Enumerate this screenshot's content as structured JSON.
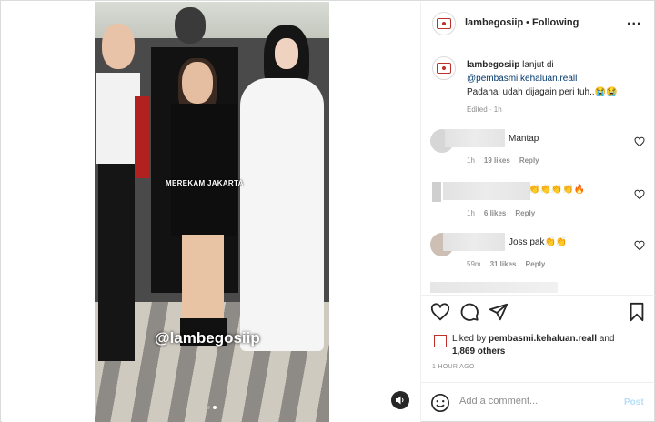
{
  "video": {
    "watermark_top": "MEREKAM JAKARTA",
    "watermark_bottom": "@lambegosiip",
    "carousel": {
      "count": 2,
      "active": 2
    }
  },
  "header": {
    "username": "lambegosiip",
    "separator": "•",
    "follow_state": "Following",
    "more_label": "..."
  },
  "caption": {
    "username": "lambegosiip",
    "line1": "lanjut di",
    "mention": "@pembasmi.kehaluan.reall",
    "line2": "Padahal udah dijagain peri tuh..😭😭",
    "meta": "Edited · 1h"
  },
  "comments": [
    {
      "text": "Mantap",
      "time": "1h",
      "likes": "19 likes",
      "reply": "Reply"
    },
    {
      "text": "👏👏👏👏🔥",
      "time": "1h",
      "likes": "6 likes",
      "reply": "Reply"
    },
    {
      "text": "Joss pak👏👏",
      "time": "59m",
      "likes": "31 likes",
      "reply": "Reply"
    }
  ],
  "liked_by": {
    "prefix": "Liked by",
    "user": "pembasmi.kehaluan.reall",
    "and": "and",
    "others": "1,869 others"
  },
  "time_ago": "1 HOUR AGO",
  "add_comment": {
    "placeholder": "Add a comment...",
    "post_label": "Post"
  },
  "colors": {
    "link": "#00376b",
    "muted": "#8e8e8e",
    "post_disabled": "#b2dffc"
  }
}
